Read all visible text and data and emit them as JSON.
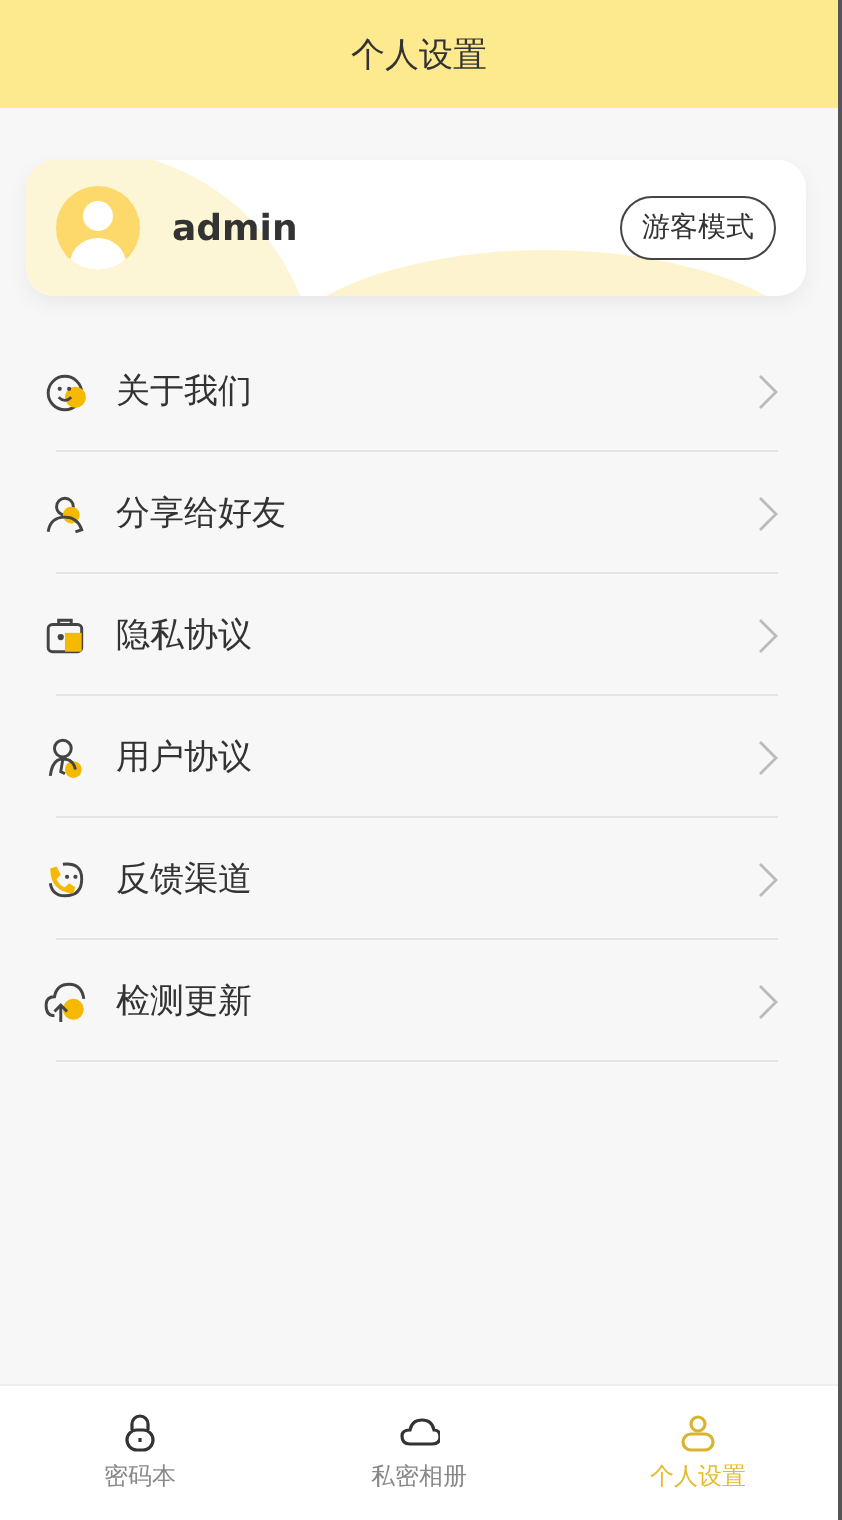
{
  "header": {
    "title": "个人设置"
  },
  "profile": {
    "username": "admin",
    "button": "游客模式"
  },
  "menu": [
    {
      "kind": "smile",
      "label": "关于我们"
    },
    {
      "kind": "share",
      "label": "分享给好友"
    },
    {
      "kind": "privacy",
      "label": "隐私协议"
    },
    {
      "kind": "user",
      "label": "用户协议"
    },
    {
      "kind": "feedback",
      "label": "反馈渠道"
    },
    {
      "kind": "update",
      "label": "检测更新"
    }
  ],
  "tabs": [
    {
      "kind": "lock",
      "label": "密码本",
      "selected": false
    },
    {
      "kind": "cloud",
      "label": "私密相册",
      "selected": false
    },
    {
      "kind": "person",
      "label": "个人设置",
      "selected": true
    }
  ]
}
